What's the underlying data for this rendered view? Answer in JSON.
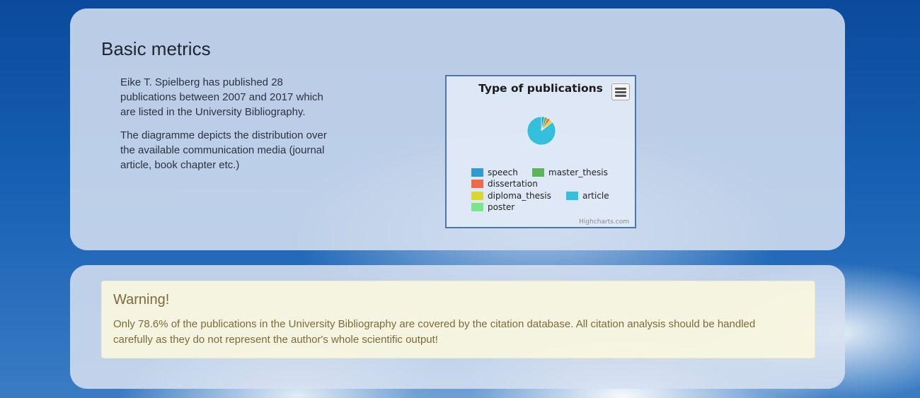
{
  "metrics": {
    "title": "Basic metrics",
    "paragraph1": "Eike T. Spielberg has published 28 publications between 2007 and 2017 which are listed in the University Bibliography.",
    "paragraph2": "The diagramme depicts the distribution over the available communication media (journal article, book chapter etc.)"
  },
  "chart_data": {
    "type": "pie",
    "title": "Type of publications",
    "series": [
      {
        "name": "speech",
        "value": 1,
        "color": "#2f9bd0"
      },
      {
        "name": "master_thesis",
        "value": 1,
        "color": "#5bb55a"
      },
      {
        "name": "dissertation",
        "value": 1,
        "color": "#ec6b4a"
      },
      {
        "name": "diploma_thesis",
        "value": 1,
        "color": "#d9d82e"
      },
      {
        "name": "article",
        "value": 24,
        "color": "#34c0dc"
      },
      {
        "name": "poster",
        "value": 0,
        "color": "#7ae68a"
      }
    ],
    "legend_position": "bottom",
    "credits": "Highcharts.com",
    "menu_icon": "hamburger-menu-icon"
  },
  "warning": {
    "title": "Warning!",
    "text": "Only 78.6% of the publications in the University Bibliography are covered by the citation database. All citation analysis should be handled carefully as they do not represent the author's whole scientific output!"
  }
}
